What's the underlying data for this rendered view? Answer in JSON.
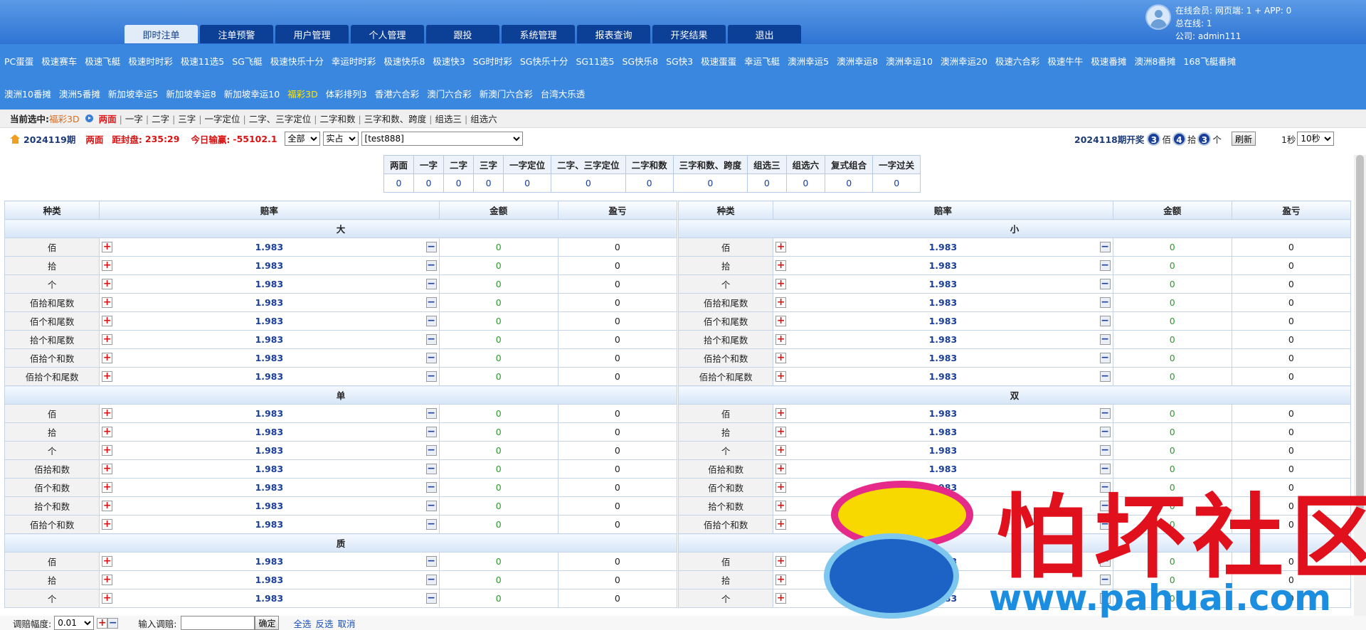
{
  "header": {
    "tabs": [
      "即时注单",
      "注单预警",
      "用户管理",
      "个人管理",
      "跟投",
      "系统管理",
      "报表查询",
      "开奖结果",
      "退出"
    ],
    "active_tab": 0,
    "online_line": "在线会员:  网页端: 1 + APP: 0",
    "total_line": "总在线:  1",
    "company_line": "公司:  admin111"
  },
  "games": {
    "row1": [
      "PC蛋蛋",
      "极速赛车",
      "极速飞艇",
      "极速时时彩",
      "极速11选5",
      "SG飞艇",
      "极速快乐十分",
      "幸运时时彩",
      "极速快乐8",
      "极速快3",
      "SG时时彩",
      "SG快乐十分",
      "SG11选5",
      "SG快乐8",
      "SG快3",
      "极速蛋蛋",
      "幸运飞艇",
      "澳洲幸运5",
      "澳洲幸运8",
      "澳洲幸运10",
      "澳洲幸运20",
      "极速六合彩",
      "极速牛牛",
      "极速番摊",
      "澳洲8番摊",
      "168飞艇番摊"
    ],
    "row2": [
      "澳洲10番摊",
      "澳洲5番摊",
      "新加坡幸运5",
      "新加坡幸运8",
      "新加坡幸运10",
      "福彩3D",
      "体彩排列3",
      "香港六合彩",
      "澳门六合彩",
      "新澳门六合彩",
      "台湾大乐透"
    ],
    "selected": "福彩3D"
  },
  "crumb": {
    "label": "当前选中:",
    "current": "福彩3D",
    "subs": [
      "两面",
      "一字",
      "二字",
      "三字",
      "一字定位",
      "二字、三字定位",
      "二字和数",
      "三字和数、跨度",
      "组选三",
      "组选六"
    ],
    "sub_active": 0
  },
  "bar": {
    "issue": "2024119期",
    "mode": "两面",
    "close_label": "距封盘:",
    "close_time": "235:29",
    "today_label": "今日输赢:",
    "today_value": "-55102.1",
    "select_all": "全部",
    "select_real": "实占",
    "select_user": "[test888]",
    "prev_issue": "2024118期开奖",
    "results": [
      {
        "num": "3",
        "unit": "佰"
      },
      {
        "num": "4",
        "unit": "拾"
      },
      {
        "num": "3",
        "unit": "个"
      }
    ],
    "refresh": "刷新",
    "interval_label": "1秒",
    "interval_select": "10秒"
  },
  "summary": {
    "headers": [
      "两面",
      "一字",
      "二字",
      "三字",
      "一字定位",
      "二字、三字定位",
      "二字和数",
      "三字和数、跨度",
      "组选三",
      "组选六",
      "复式组合",
      "一字过关"
    ],
    "values": [
      "0",
      "0",
      "0",
      "0",
      "0",
      "0",
      "0",
      "0",
      "0",
      "0",
      "0",
      "0"
    ]
  },
  "table_headers": [
    "种类",
    "赔率",
    "金额",
    "盈亏"
  ],
  "left_sections": [
    {
      "title": "大",
      "rows": [
        {
          "kind": "佰",
          "odds": "1.983",
          "amount": "0",
          "pnl": "0"
        },
        {
          "kind": "拾",
          "odds": "1.983",
          "amount": "0",
          "pnl": "0"
        },
        {
          "kind": "个",
          "odds": "1.983",
          "amount": "0",
          "pnl": "0"
        },
        {
          "kind": "佰拾和尾数",
          "odds": "1.983",
          "amount": "0",
          "pnl": "0"
        },
        {
          "kind": "佰个和尾数",
          "odds": "1.983",
          "amount": "0",
          "pnl": "0"
        },
        {
          "kind": "拾个和尾数",
          "odds": "1.983",
          "amount": "0",
          "pnl": "0"
        },
        {
          "kind": "佰拾个和数",
          "odds": "1.983",
          "amount": "0",
          "pnl": "0"
        },
        {
          "kind": "佰拾个和尾数",
          "odds": "1.983",
          "amount": "0",
          "pnl": "0"
        }
      ]
    },
    {
      "title": "单",
      "rows": [
        {
          "kind": "佰",
          "odds": "1.983",
          "amount": "0",
          "pnl": "0"
        },
        {
          "kind": "拾",
          "odds": "1.983",
          "amount": "0",
          "pnl": "0"
        },
        {
          "kind": "个",
          "odds": "1.983",
          "amount": "0",
          "pnl": "0"
        },
        {
          "kind": "佰拾和数",
          "odds": "1.983",
          "amount": "0",
          "pnl": "0"
        },
        {
          "kind": "佰个和数",
          "odds": "1.983",
          "amount": "0",
          "pnl": "0"
        },
        {
          "kind": "拾个和数",
          "odds": "1.983",
          "amount": "0",
          "pnl": "0"
        },
        {
          "kind": "佰拾个和数",
          "odds": "1.983",
          "amount": "0",
          "pnl": "0"
        }
      ]
    },
    {
      "title": "质",
      "rows": [
        {
          "kind": "佰",
          "odds": "1.983",
          "amount": "0",
          "pnl": "0"
        },
        {
          "kind": "拾",
          "odds": "1.983",
          "amount": "0",
          "pnl": "0"
        },
        {
          "kind": "个",
          "odds": "1.983",
          "amount": "0",
          "pnl": "0"
        }
      ]
    }
  ],
  "right_sections": [
    {
      "title": "小",
      "rows": [
        {
          "kind": "佰",
          "odds": "1.983",
          "amount": "0",
          "pnl": "0"
        },
        {
          "kind": "拾",
          "odds": "1.983",
          "amount": "0",
          "pnl": "0"
        },
        {
          "kind": "个",
          "odds": "1.983",
          "amount": "0",
          "pnl": "0"
        },
        {
          "kind": "佰拾和尾数",
          "odds": "1.983",
          "amount": "0",
          "pnl": "0"
        },
        {
          "kind": "佰个和尾数",
          "odds": "1.983",
          "amount": "0",
          "pnl": "0"
        },
        {
          "kind": "拾个和尾数",
          "odds": "1.983",
          "amount": "0",
          "pnl": "0"
        },
        {
          "kind": "佰拾个和数",
          "odds": "1.983",
          "amount": "0",
          "pnl": "0"
        },
        {
          "kind": "佰拾个和尾数",
          "odds": "1.983",
          "amount": "0",
          "pnl": "0"
        }
      ]
    },
    {
      "title": "双",
      "rows": [
        {
          "kind": "佰",
          "odds": "1.983",
          "amount": "0",
          "pnl": "0"
        },
        {
          "kind": "拾",
          "odds": "1.983",
          "amount": "0",
          "pnl": "0"
        },
        {
          "kind": "个",
          "odds": "1.983",
          "amount": "0",
          "pnl": "0"
        },
        {
          "kind": "佰拾和数",
          "odds": "1.983",
          "amount": "0",
          "pnl": "0"
        },
        {
          "kind": "佰个和数",
          "odds": "1.983",
          "amount": "0",
          "pnl": "0"
        },
        {
          "kind": "拾个和数",
          "odds": "1.983",
          "amount": "0",
          "pnl": "0"
        },
        {
          "kind": "佰拾个和数",
          "odds": "1.983",
          "amount": "0",
          "pnl": "0"
        }
      ]
    },
    {
      "title": "",
      "rows": [
        {
          "kind": "佰",
          "odds": "1.983",
          "amount": "0",
          "pnl": "0"
        },
        {
          "kind": "拾",
          "odds": "1.983",
          "amount": "0",
          "pnl": "0"
        },
        {
          "kind": "个",
          "odds": "1.983",
          "amount": "0",
          "pnl": "0"
        }
      ]
    }
  ],
  "footer": {
    "step_label": "调赔幅度:",
    "step_value": "0.01",
    "input_label": "输入调赔:",
    "confirm": "确定",
    "links": [
      "全选",
      "反选",
      "取消"
    ]
  },
  "watermark": {
    "text": "怕坏社区",
    "url": "www.pahuai.com"
  },
  "colors": {
    "header_blue": "#3a87e0",
    "tab_navy": "#0c3f96",
    "odds_blue": "#1a3f9a",
    "amount_green": "#2c9a2c",
    "alert_red": "#d81313"
  },
  "icons": [
    "user-avatar-icon",
    "home-icon",
    "play-arrow-icon",
    "plus-icon",
    "minus-icon"
  ]
}
